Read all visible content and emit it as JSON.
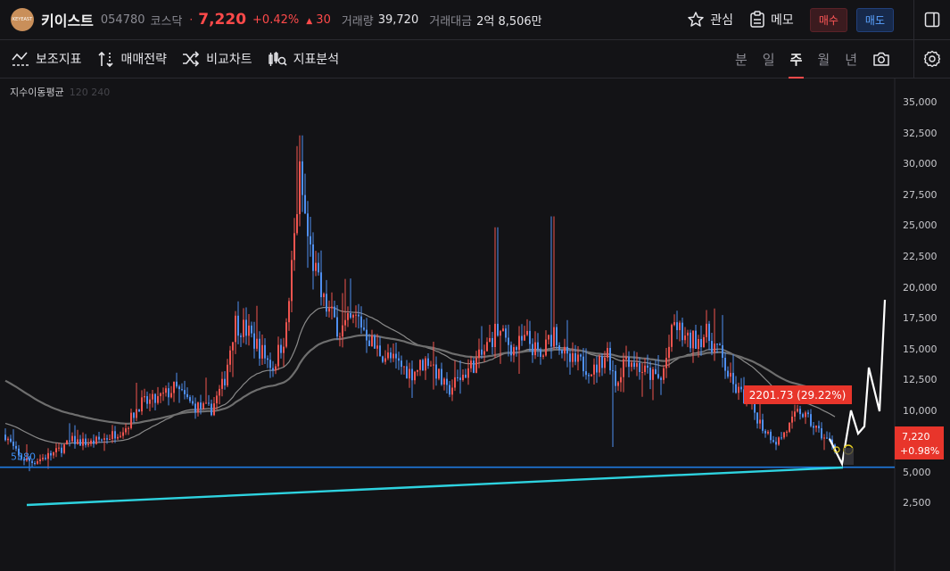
{
  "header": {
    "logo_text": "KEYEAST",
    "name": "키이스트",
    "code": "054780",
    "market": "코스닥",
    "dot": "·",
    "price": "7,220",
    "change_pct": "+0.42%",
    "change_arrow": "▲",
    "change_val": "30",
    "volume_label": "거래량",
    "volume": "39,720",
    "amount_label": "거래대금",
    "amount": "2억 8,506만",
    "watch_label": "관심",
    "memo_label": "메모",
    "buy_label": "매수",
    "sell_label": "매도"
  },
  "toolbar": {
    "items": [
      "보조지표",
      "매매전략",
      "비교차트",
      "지표분석"
    ],
    "periods": [
      "분",
      "일",
      "주",
      "월",
      "년"
    ],
    "active_period": "주"
  },
  "legend": {
    "title": "지수이동평균",
    "params": "120 240"
  },
  "chart_data": {
    "type": "candlestick",
    "y_ticks": [
      "35,000",
      "32,500",
      "30,000",
      "27,500",
      "25,000",
      "22,500",
      "20,000",
      "17,500",
      "15,000",
      "12,500",
      "10,000",
      "7,500",
      "5,000",
      "2,500"
    ],
    "y_tick_values": [
      35000,
      32500,
      30000,
      27500,
      25000,
      22500,
      20000,
      17500,
      15000,
      12500,
      10000,
      7500,
      5000,
      2500
    ],
    "support_level": 5380,
    "support_label": "5380",
    "annotation_label": "2201.73 (29.22%)",
    "current_price_label": "7,220",
    "current_change_label": "+0.98%",
    "colors": {
      "up": "#f0544f",
      "down": "#4f8ff0",
      "support": "#1f7ae0",
      "trend": "#2ed3e0",
      "projection": "#ffffff",
      "annotation": "#e8352b"
    }
  }
}
